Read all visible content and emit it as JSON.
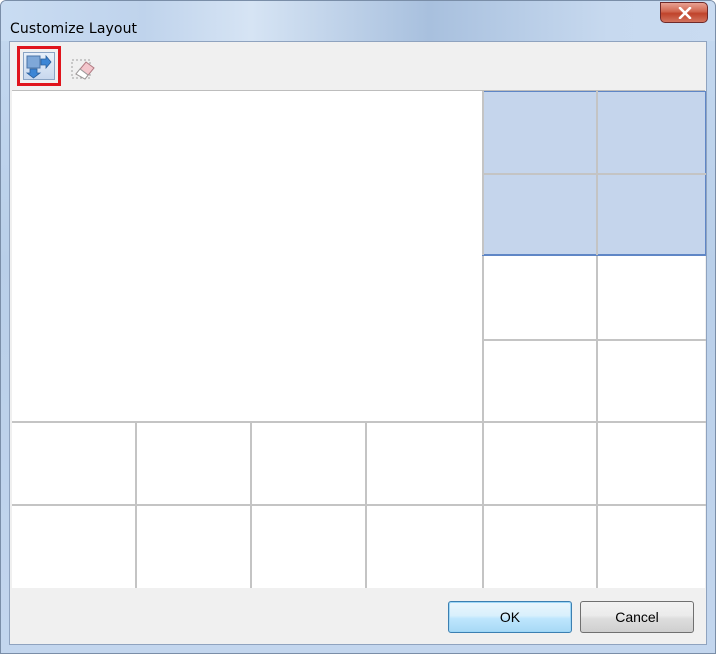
{
  "window": {
    "title": "Customize Layout"
  },
  "toolbar": {
    "tools": [
      {
        "name": "define-layout",
        "icon": "layout-arrows-icon",
        "selected": true
      },
      {
        "name": "clear-layout",
        "icon": "eraser-icon",
        "selected": false
      }
    ]
  },
  "grid": {
    "rows": 6,
    "columns": 6,
    "selected_region": {
      "rows": "1-2",
      "columns": "5-6"
    },
    "merged_region": {
      "rows": "1-4",
      "columns": "1-4"
    }
  },
  "buttons": {
    "ok_label": "OK",
    "cancel_label": "Cancel"
  },
  "colors": {
    "selection_fill": "#c5d5ec",
    "selection_border": "#5f86c6",
    "grid_line": "#c4c4c4",
    "tool_highlight": "#e0141c",
    "close_button": "#c0432b"
  }
}
